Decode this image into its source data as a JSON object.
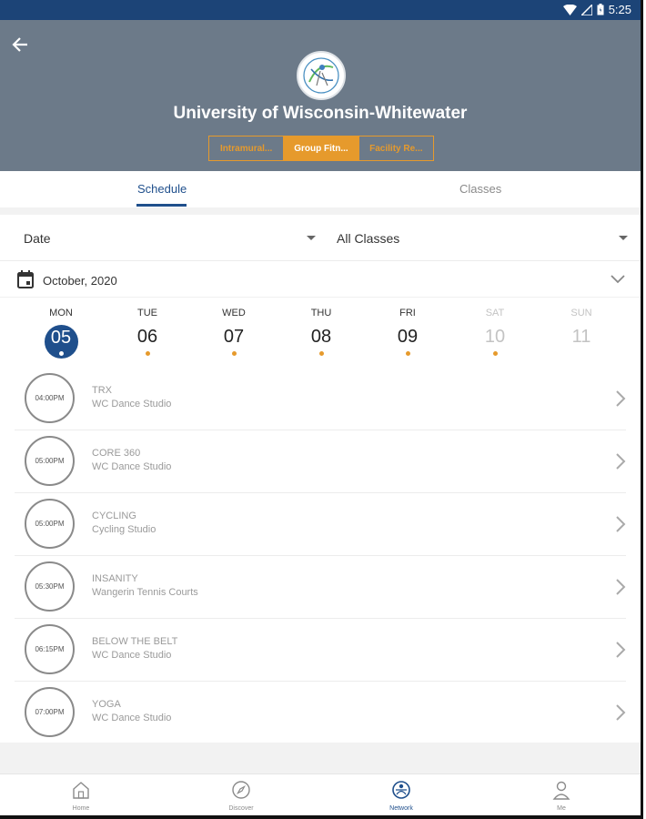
{
  "status": {
    "time": "5:25"
  },
  "header": {
    "title": "University of Wisconsin-Whitewater",
    "segments": [
      "Intramural...",
      "Group Fitn...",
      "Facility Re..."
    ],
    "active_segment": 1
  },
  "tabs": {
    "schedule": "Schedule",
    "classes": "Classes"
  },
  "filters": {
    "date": "Date",
    "classes": "All Classes"
  },
  "month": {
    "label": "October,  2020"
  },
  "days": [
    {
      "name": "MON",
      "num": "05",
      "selected": true,
      "dot": true
    },
    {
      "name": "TUE",
      "num": "06",
      "dot": true
    },
    {
      "name": "WED",
      "num": "07",
      "dot": true
    },
    {
      "name": "THU",
      "num": "08",
      "dot": true
    },
    {
      "name": "FRI",
      "num": "09",
      "dot": true
    },
    {
      "name": "SAT",
      "num": "10",
      "muted": true,
      "dot": true
    },
    {
      "name": "SUN",
      "num": "11",
      "muted": true,
      "dot": false
    }
  ],
  "classes": [
    {
      "time": "04:00PM",
      "name": "TRX",
      "location": "WC Dance Studio"
    },
    {
      "time": "05:00PM",
      "name": "CORE 360",
      "location": "WC Dance Studio"
    },
    {
      "time": "05:00PM",
      "name": "CYCLING",
      "location": "Cycling Studio"
    },
    {
      "time": "05:30PM",
      "name": "INSANITY",
      "location": "Wangerin Tennis Courts"
    },
    {
      "time": "06:15PM",
      "name": "BELOW THE BELT",
      "location": "WC Dance Studio"
    },
    {
      "time": "07:00PM",
      "name": "YOGA",
      "location": "WC Dance Studio"
    }
  ],
  "nav": [
    {
      "label": "Home",
      "icon": "home-icon"
    },
    {
      "label": "Discover",
      "icon": "compass-icon"
    },
    {
      "label": "Network",
      "icon": "network-icon",
      "active": true
    },
    {
      "label": "Me",
      "icon": "person-icon"
    }
  ],
  "colors": {
    "header_bg": "#6c7a89",
    "accent": "#e69a2c",
    "primary": "#1f4f8c",
    "statusbar": "#1c4477"
  }
}
